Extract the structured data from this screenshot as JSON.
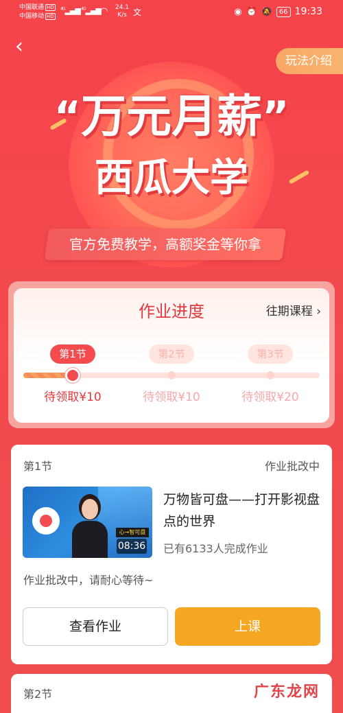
{
  "status_bar": {
    "carrier_1": "中国联通",
    "carrier_2": "中国移动",
    "hd_tag": "HD",
    "network_1": "4G",
    "network_2": "4G",
    "speed_value": "24.1",
    "speed_unit": "K/s",
    "battery": "66",
    "time": "19:33"
  },
  "header": {
    "back_icon": "‹",
    "rules_button": "玩法介绍"
  },
  "hero": {
    "title_open_quote": "“",
    "title": "万元月薪",
    "title_close_quote": "”",
    "subtitle": "西瓜大学",
    "tagline": "官方免费教学，高额奖金等你拿"
  },
  "progress": {
    "title": "作业进度",
    "past_courses_label": "往期课程",
    "past_courses_chevron": "›",
    "steps": [
      {
        "label": "第1节",
        "reward": "待领取¥10"
      },
      {
        "label": "第2节",
        "reward": "待领取¥10"
      },
      {
        "label": "第3节",
        "reward": "待领取¥20"
      }
    ],
    "current_step": 1,
    "fill_fraction": 0.15
  },
  "lesson": {
    "number": "第1节",
    "status": "作业批改中",
    "thumbnail_sign": "心→智可盘",
    "duration": "08:36",
    "title": "万物皆可盘——打开影视盘点的世界",
    "completed_count": "已有6133人完成作业",
    "note": "作业批改中，请耐心等待~",
    "view_button": "查看作业",
    "class_button": "上课"
  },
  "next_lesson": {
    "number": "第2节"
  },
  "watermark": "广东龙网",
  "colors": {
    "background": "#f5434a",
    "accent_red": "#f44b4f",
    "button_orange": "#f5a623",
    "rules_orange": "#f8a864"
  }
}
